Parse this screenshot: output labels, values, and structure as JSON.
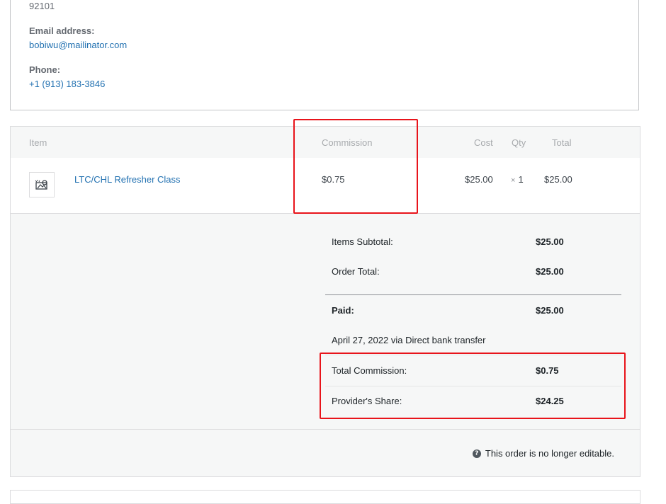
{
  "address": {
    "zip": "92101",
    "email_label": "Email address:",
    "email": "bobiwu@mailinator.com",
    "phone_label": "Phone:",
    "phone": "+1 (913) 183-3846"
  },
  "items_table": {
    "headers": {
      "item": "Item",
      "commission": "Commission",
      "cost": "Cost",
      "qty": "Qty",
      "total": "Total"
    },
    "rows": [
      {
        "name": "LTC/CHL Refresher Class",
        "commission": "$0.75",
        "cost": "$25.00",
        "qty_prefix": "×",
        "qty": "1",
        "total": "$25.00",
        "thumb_icon": "product-placeholder-icon"
      }
    ]
  },
  "totals": {
    "items_subtotal_label": "Items Subtotal:",
    "items_subtotal": "$25.00",
    "order_total_label": "Order Total:",
    "order_total": "$25.00",
    "paid_label": "Paid:",
    "paid": "$25.00",
    "paid_note": "April 27, 2022 via Direct bank transfer",
    "total_commission_label": "Total Commission:",
    "total_commission": "$0.75",
    "provider_share_label": "Provider's Share:",
    "provider_share": "$24.25"
  },
  "footer": {
    "help_icon": "question-circle-icon",
    "help_glyph": "?",
    "not_editable": "This order is no longer editable."
  },
  "colors": {
    "link": "#2271b1",
    "highlight": "#e8141b"
  }
}
